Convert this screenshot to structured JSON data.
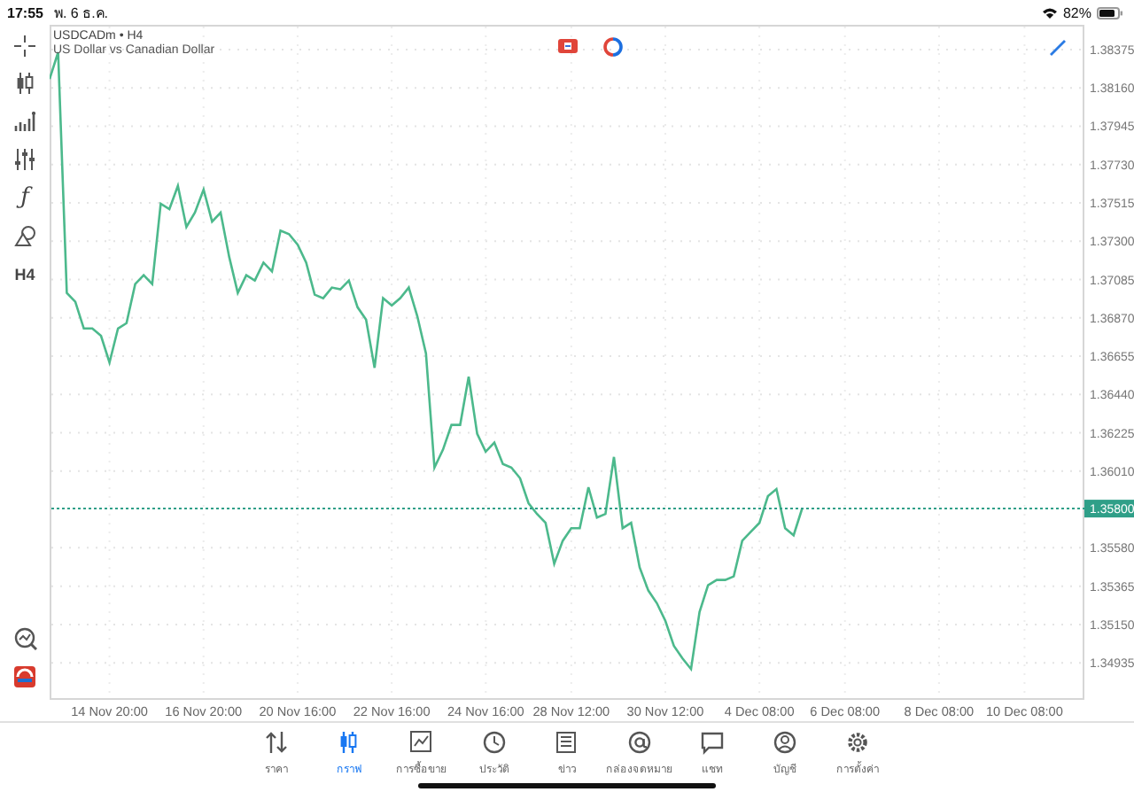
{
  "status_bar": {
    "time": "17:55",
    "date": "พ. 6 ธ.ค.",
    "battery": "82%"
  },
  "side_toolbar": {
    "function_button": "ƒ",
    "timeframe_button": "H4"
  },
  "chart": {
    "symbol": "USDCADm • H4",
    "description": "US Dollar vs Canadian Dollar",
    "chart_data": {
      "type": "line",
      "grid": true,
      "ylim": [
        1.34727,
        1.38514
      ],
      "categories": [
        null,
        null,
        null,
        null,
        null,
        null,
        null,
        "14 Nov 20:00",
        null,
        null,
        null,
        null,
        null,
        null,
        null,
        null,
        null,
        null,
        "16 Nov 20:00",
        null,
        null,
        null,
        null,
        null,
        null,
        null,
        null,
        null,
        null,
        "20 Nov 16:00",
        null,
        null,
        null,
        null,
        null,
        null,
        null,
        null,
        null,
        null,
        "22 Nov 16:00",
        null,
        null,
        null,
        null,
        null,
        null,
        null,
        null,
        null,
        null,
        "24 Nov 16:00",
        null,
        null,
        null,
        null,
        null,
        null,
        null,
        null,
        null,
        "28 Nov 12:00",
        null,
        null,
        null,
        null,
        null,
        null,
        null,
        null,
        null,
        null,
        "30 Nov 12:00",
        null,
        null,
        null,
        null,
        null,
        null,
        null,
        null,
        null,
        null,
        "4 Dec 08:00",
        null,
        null,
        null,
        null,
        null,
        null,
        null,
        null,
        null,
        "6 Dec 08:00",
        null,
        null,
        null,
        null,
        null,
        null,
        null,
        null,
        null,
        null,
        "8 Dec 08:00",
        null,
        null,
        null,
        null,
        null,
        null,
        null,
        null,
        null,
        "10 Dec 08:00",
        null,
        null,
        null,
        null,
        null,
        null,
        null
      ],
      "yticks": [
        {
          "value": 1.38375,
          "label": "1.38375"
        },
        {
          "value": 1.3816,
          "label": "1.38160"
        },
        {
          "value": 1.37945,
          "label": "1.37945"
        },
        {
          "value": 1.3773,
          "label": "1.37730"
        },
        {
          "value": 1.37515,
          "label": "1.37515"
        },
        {
          "value": 1.373,
          "label": "1.37300"
        },
        {
          "value": 1.37085,
          "label": "1.37085"
        },
        {
          "value": 1.3687,
          "label": "1.36870"
        },
        {
          "value": 1.36655,
          "label": "1.36655"
        },
        {
          "value": 1.3644,
          "label": "1.36440"
        },
        {
          "value": 1.36225,
          "label": "1.36225"
        },
        {
          "value": 1.3601,
          "label": "1.36010"
        },
        {
          "value": 1.3558,
          "label": "1.35580"
        },
        {
          "value": 1.35365,
          "label": "1.35365"
        },
        {
          "value": 1.3515,
          "label": "1.35150"
        },
        {
          "value": 1.34935,
          "label": "1.34935"
        }
      ],
      "ref_lines": [
        {
          "axis": "y",
          "value": 1.358,
          "label": "1.35800",
          "color": "#2f9f88"
        }
      ],
      "series": [
        {
          "color": "#4cb98c",
          "values": [
            1.3821,
            1.3836,
            1.3701,
            1.3696,
            1.3681,
            1.3681,
            1.3677,
            1.3662,
            1.3681,
            1.3684,
            1.3706,
            1.3711,
            1.3706,
            1.3751,
            1.3748,
            1.3761,
            1.3738,
            1.3746,
            1.3759,
            1.3741,
            1.3746,
            1.3721,
            1.3701,
            1.3711,
            1.3708,
            1.3718,
            1.3713,
            1.3736,
            1.3734,
            1.3728,
            1.3718,
            1.37,
            1.3698,
            1.3704,
            1.3703,
            1.3708,
            1.3693,
            1.3686,
            1.3659,
            1.3698,
            1.3694,
            1.3698,
            1.3704,
            1.3688,
            1.3667,
            1.3603,
            1.3613,
            1.3627,
            1.3627,
            1.3654,
            1.3622,
            1.3612,
            1.3617,
            1.3605,
            1.3603,
            1.3597,
            1.3583,
            1.3577,
            1.3572,
            1.3549,
            1.3562,
            1.3569,
            1.3569,
            1.3592,
            1.3575,
            1.3577,
            1.3609,
            1.3569,
            1.3572,
            1.3547,
            1.3534,
            1.3527,
            1.3517,
            1.3503,
            1.3496,
            1.349,
            1.3522,
            1.3537,
            1.354,
            1.354,
            1.3542,
            1.3562,
            1.3567,
            1.3572,
            1.3587,
            1.3591,
            1.3569,
            1.3565,
            1.358,
            null,
            null,
            null,
            null,
            null,
            null,
            null,
            null,
            null,
            null,
            null,
            null,
            null,
            null,
            null,
            null,
            null,
            null,
            null,
            null,
            null,
            null,
            null,
            null,
            null,
            null,
            null,
            null,
            null,
            null,
            null,
            null,
            null
          ]
        }
      ]
    }
  },
  "tabs": [
    {
      "label": "ราคา",
      "selected": false
    },
    {
      "label": "กราฟ",
      "selected": true
    },
    {
      "label": "การซื้อขาย",
      "selected": false
    },
    {
      "label": "ประวัติ",
      "selected": false
    },
    {
      "label": "ข่าว",
      "selected": false
    },
    {
      "label": "กล่องจดหมาย",
      "selected": false
    },
    {
      "label": "แชท",
      "selected": false
    },
    {
      "label": "บัญชี",
      "selected": false
    },
    {
      "label": "การตั้งค่า",
      "selected": false
    }
  ]
}
